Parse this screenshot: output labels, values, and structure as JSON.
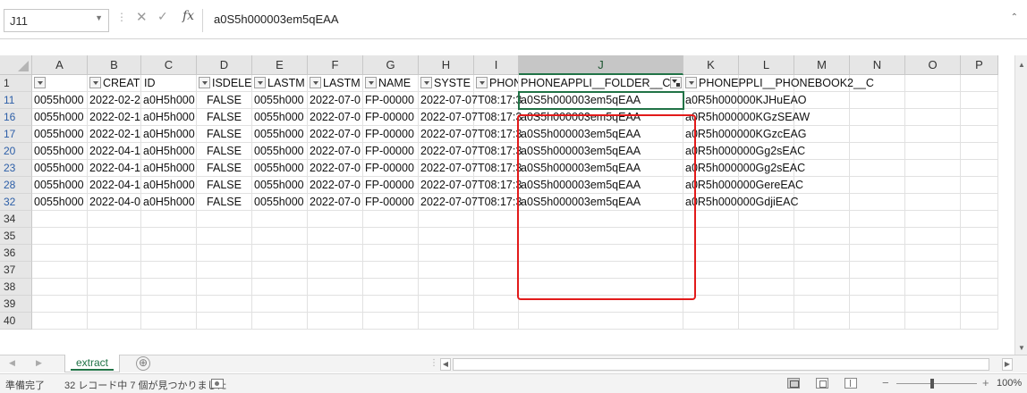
{
  "formula_bar": {
    "name_box": "J11",
    "formula_value": "a0S5h000003em5qEAA"
  },
  "columns": [
    {
      "letter": "A",
      "width": 62
    },
    {
      "letter": "B",
      "width": 60
    },
    {
      "letter": "C",
      "width": 62
    },
    {
      "letter": "D",
      "width": 62
    },
    {
      "letter": "E",
      "width": 62
    },
    {
      "letter": "F",
      "width": 62
    },
    {
      "letter": "G",
      "width": 62
    },
    {
      "letter": "H",
      "width": 62
    },
    {
      "letter": "I",
      "width": 50
    },
    {
      "letter": "J",
      "width": 184,
      "selected": true
    },
    {
      "letter": "K",
      "width": 62
    },
    {
      "letter": "L",
      "width": 62
    },
    {
      "letter": "M",
      "width": 62
    },
    {
      "letter": "N",
      "width": 62
    },
    {
      "letter": "O",
      "width": 62
    },
    {
      "letter": "P",
      "width": 42
    }
  ],
  "header_row": {
    "row_number": "1",
    "cells": [
      {
        "text": "",
        "filter": "dropdown",
        "align": "right"
      },
      {
        "text": "CREAT",
        "filter": "dropdown",
        "align": "right"
      },
      {
        "text": "ID",
        "filter": "none"
      },
      {
        "text": "ISDELE",
        "filter": "dropdown",
        "align": "right"
      },
      {
        "text": "LASTM",
        "filter": "dropdown",
        "align": "right"
      },
      {
        "text": "LASTM",
        "filter": "dropdown",
        "align": "right"
      },
      {
        "text": "NAME",
        "filter": "dropdown",
        "align": "right"
      },
      {
        "text": "SYSTE",
        "filter": "dropdown",
        "align": "right"
      },
      {
        "text": "PHONE",
        "filter": "dropdown",
        "align": "right"
      },
      {
        "text": "PHONEAPPLI__FOLDER__C",
        "filter": "applied",
        "align": "right"
      },
      {
        "text": "PHONE",
        "filter": "dropdown",
        "align": "right",
        "overflow": true,
        "overflow_text": "PPLI__PHONEBOOK2__C"
      }
    ]
  },
  "rows": [
    {
      "n": "11",
      "filtered": true,
      "cells": [
        "0055h000",
        "2022-02-2",
        "a0H5h000",
        "FALSE",
        "0055h000",
        "2022-07-0",
        "FP-00000",
        "2022-07-07T08:17:3",
        "",
        "a0S5h000003em5qEAA",
        "a0R5h000000KJHuEAO"
      ]
    },
    {
      "n": "16",
      "filtered": true,
      "cells": [
        "0055h000",
        "2022-02-1",
        "a0H5h000",
        "FALSE",
        "0055h000",
        "2022-07-0",
        "FP-00000",
        "2022-07-07T08:17:3",
        "",
        "a0S5h000003em5qEAA",
        "a0R5h000000KGzSEAW"
      ]
    },
    {
      "n": "17",
      "filtered": true,
      "cells": [
        "0055h000",
        "2022-02-1",
        "a0H5h000",
        "FALSE",
        "0055h000",
        "2022-07-0",
        "FP-00000",
        "2022-07-07T08:17:3",
        "",
        "a0S5h000003em5qEAA",
        "a0R5h000000KGzcEAG"
      ]
    },
    {
      "n": "20",
      "filtered": true,
      "cells": [
        "0055h000",
        "2022-04-1",
        "a0H5h000",
        "FALSE",
        "0055h000",
        "2022-07-0",
        "FP-00000",
        "2022-07-07T08:17:3",
        "",
        "a0S5h000003em5qEAA",
        "a0R5h000000Gg2sEAC"
      ]
    },
    {
      "n": "23",
      "filtered": true,
      "cells": [
        "0055h000",
        "2022-04-1",
        "a0H5h000",
        "FALSE",
        "0055h000",
        "2022-07-0",
        "FP-00000",
        "2022-07-07T08:17:3",
        "",
        "a0S5h000003em5qEAA",
        "a0R5h000000Gg2sEAC"
      ]
    },
    {
      "n": "28",
      "filtered": true,
      "cells": [
        "0055h000",
        "2022-04-1",
        "a0H5h000",
        "FALSE",
        "0055h000",
        "2022-07-0",
        "FP-00000",
        "2022-07-07T08:17:3",
        "",
        "a0S5h000003em5qEAA",
        "a0R5h000000GereEAC"
      ]
    },
    {
      "n": "32",
      "filtered": true,
      "cells": [
        "0055h000",
        "2022-04-0",
        "a0H5h000",
        "FALSE",
        "0055h000",
        "2022-07-0",
        "FP-00000",
        "2022-07-07T08:17:3",
        "",
        "a0S5h000003em5qEAA",
        "a0R5h000000GdjiEAC"
      ]
    },
    {
      "n": "34",
      "cells": []
    },
    {
      "n": "35",
      "cells": []
    },
    {
      "n": "36",
      "cells": []
    },
    {
      "n": "37",
      "cells": []
    },
    {
      "n": "38",
      "cells": []
    },
    {
      "n": "39",
      "cells": []
    },
    {
      "n": "40",
      "cells": []
    }
  ],
  "sheet_tabs": [
    {
      "label": "extract",
      "active": true
    }
  ],
  "add_sheet_symbol": "⊕",
  "status_bar": {
    "ready": "準備完了",
    "record_count": "32 レコード中 7 個が見つかりました",
    "zoom_level": "100%"
  },
  "highlight_color": "#e21a1a",
  "accent_color": "#217346"
}
